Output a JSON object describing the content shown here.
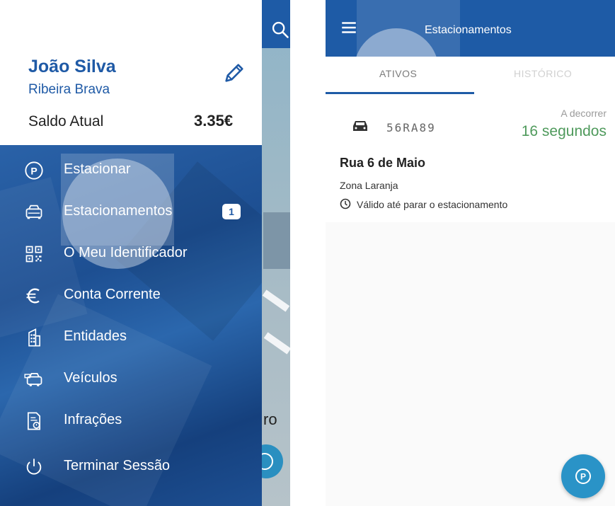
{
  "colors": {
    "primary": "#1e5ba6",
    "drawer_bg": "#1d4f92",
    "elapsed_green": "#4f9a5c",
    "fab": "#2a93c7"
  },
  "drawer": {
    "user_name": "João Silva",
    "user_location": "Ribeira Brava",
    "balance_label": "Saldo Atual",
    "balance_value": "3.35€",
    "edit_icon": "pencil-icon",
    "items": [
      {
        "label": "Estacionar",
        "icon": "parking-circle-icon"
      },
      {
        "label": "Estacionamentos",
        "icon": "car-icon",
        "badge": "1"
      },
      {
        "label": "O Meu Identificador",
        "icon": "qr-code-icon"
      },
      {
        "label": "Conta Corrente",
        "icon": "euro-icon"
      },
      {
        "label": "Entidades",
        "icon": "building-icon"
      },
      {
        "label": "Veículos",
        "icon": "vehicle-icon"
      },
      {
        "label": "Infrações",
        "icon": "ticket-icon"
      },
      {
        "label": "Terminar Sessão",
        "icon": "power-icon"
      }
    ]
  },
  "map_partial": {
    "label": "ro"
  },
  "right": {
    "title": "Estacionamentos",
    "tabs": [
      {
        "label": "ATIVOS",
        "active": true
      },
      {
        "label": "HISTÓRICO",
        "active": false
      }
    ],
    "parking": {
      "plate": "56RA89",
      "status": "A decorrer",
      "elapsed": "16 segundos",
      "street": "Rua 6 de Maio",
      "zone": "Zona Laranja",
      "validity": "Válido até parar o estacionamento"
    }
  }
}
